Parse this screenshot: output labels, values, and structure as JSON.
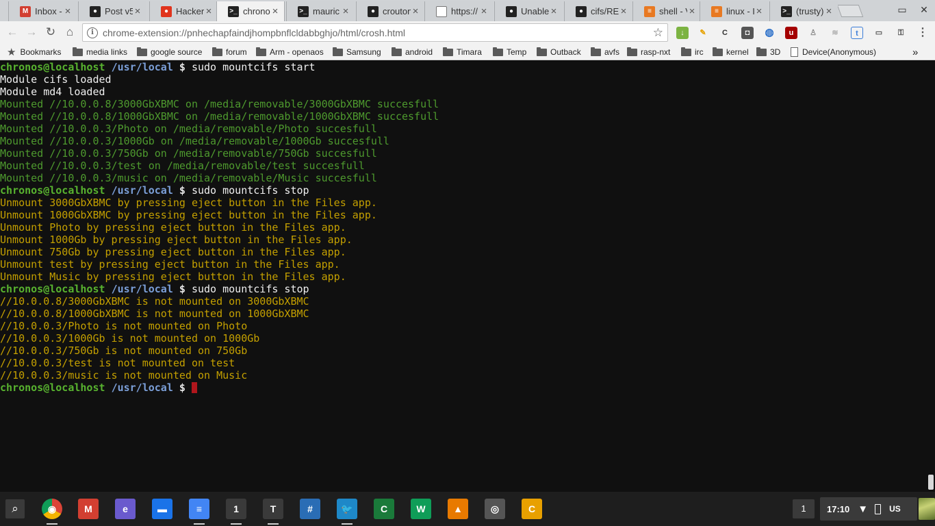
{
  "tabs": [
    {
      "title": "Inbox -",
      "icon": "gmail-icon",
      "color": "#d23f31",
      "glyph": "M"
    },
    {
      "title": "Post v5",
      "icon": "github-icon",
      "color": "#222222",
      "glyph": "●"
    },
    {
      "title": "Hacker",
      "icon": "hacker-news-icon",
      "color": "#e0331c",
      "glyph": "●"
    },
    {
      "title": "chrono",
      "icon": "terminal-icon",
      "color": "#222222",
      "glyph": ">_",
      "active": true
    },
    {
      "title": "mauric",
      "icon": "terminal-icon",
      "color": "#222222",
      "glyph": ">_"
    },
    {
      "title": "crouton",
      "icon": "github-icon",
      "color": "#222222",
      "glyph": "●"
    },
    {
      "title": "https://",
      "icon": "page-icon",
      "color": "#ffffff",
      "glyph": ""
    },
    {
      "title": "Unable",
      "icon": "github-icon",
      "color": "#222222",
      "glyph": "●"
    },
    {
      "title": "cifs/RE",
      "icon": "github-icon",
      "color": "#222222",
      "glyph": "●"
    },
    {
      "title": "shell - V",
      "icon": "stackexchange-icon",
      "color": "#e87922",
      "glyph": "≡"
    },
    {
      "title": "linux - I",
      "icon": "stackoverflow-icon",
      "color": "#e87922",
      "glyph": "≡"
    },
    {
      "title": "(trusty)",
      "icon": "terminal-icon",
      "color": "#222222",
      "glyph": ">_"
    }
  ],
  "toolbar": {
    "url": "chrome-extension://pnhechapfaindjhompbnflcldabbghjo/html/crosh.html",
    "info_glyph": "i",
    "star_glyph": "☆"
  },
  "bookmarks": {
    "label": "Bookmarks",
    "folders": [
      "media links",
      "google source",
      "forum",
      "Arm - openaos",
      "Samsung",
      "android",
      "Timara",
      "Temp",
      "Outback",
      "avfs",
      "rasp-nxt",
      "irc",
      "kernel",
      "3D"
    ],
    "page": "Device(Anonymous)",
    "overflow": "»"
  },
  "terminal": {
    "prompt_user": "chronos@localhost",
    "prompt_path": "/usr/local",
    "prompt_symbol": "$",
    "lines": [
      {
        "type": "prompt",
        "cmd": "sudo mountcifs start"
      },
      {
        "type": "white",
        "text": "Module cifs loaded"
      },
      {
        "type": "white",
        "text": "Module md4 loaded"
      },
      {
        "type": "green",
        "text": "Mounted //10.0.0.8/3000GbXBMC on /media/removable/3000GbXBMC succesfull"
      },
      {
        "type": "green",
        "text": "Mounted //10.0.0.8/1000GbXBMC on /media/removable/1000GbXBMC succesfull"
      },
      {
        "type": "green",
        "text": "Mounted //10.0.0.3/Photo on /media/removable/Photo succesfull"
      },
      {
        "type": "green",
        "text": "Mounted //10.0.0.3/1000Gb on /media/removable/1000Gb succesfull"
      },
      {
        "type": "green",
        "text": "Mounted //10.0.0.3/750Gb on /media/removable/750Gb succesfull"
      },
      {
        "type": "green",
        "text": "Mounted //10.0.0.3/test on /media/removable/test succesfull"
      },
      {
        "type": "green",
        "text": "Mounted //10.0.0.3/music on /media/removable/Music succesfull"
      },
      {
        "type": "prompt",
        "cmd": "sudo mountcifs stop"
      },
      {
        "type": "yellow",
        "text": "Unmount 3000GbXBMC by pressing eject button in the Files app."
      },
      {
        "type": "yellow",
        "text": "Unmount 1000GbXBMC by pressing eject button in the Files app."
      },
      {
        "type": "yellow",
        "text": "Unmount Photo by pressing eject button in the Files app."
      },
      {
        "type": "yellow",
        "text": "Unmount 1000Gb by pressing eject button in the Files app."
      },
      {
        "type": "yellow",
        "text": "Unmount 750Gb by pressing eject button in the Files app."
      },
      {
        "type": "yellow",
        "text": "Unmount test by pressing eject button in the Files app."
      },
      {
        "type": "yellow",
        "text": "Unmount Music by pressing eject button in the Files app."
      },
      {
        "type": "prompt",
        "cmd": "sudo mountcifs stop"
      },
      {
        "type": "yellow",
        "text": "//10.0.0.8/3000GbXBMC is not mounted on 3000GbXBMC"
      },
      {
        "type": "yellow",
        "text": "//10.0.0.8/1000GbXBMC is not mounted on 1000GbXBMC"
      },
      {
        "type": "yellow",
        "text": "//10.0.0.3/Photo is not mounted on Photo"
      },
      {
        "type": "yellow",
        "text": "//10.0.0.3/1000Gb is not mounted on 1000Gb"
      },
      {
        "type": "yellow",
        "text": "//10.0.0.3/750Gb is not mounted on 750Gb"
      },
      {
        "type": "yellow",
        "text": "//10.0.0.3/test is not mounted on test"
      },
      {
        "type": "yellow",
        "text": "//10.0.0.3/music is not mounted on Music"
      },
      {
        "type": "prompt",
        "cmd": "",
        "cursor": true
      }
    ]
  },
  "shelf": {
    "apps": [
      {
        "name": "chrome-icon",
        "color": "#4285f4",
        "glyph": "◉"
      },
      {
        "name": "gmail-icon",
        "color": "#d23f31",
        "glyph": "M"
      },
      {
        "name": "ssh-app-icon",
        "color": "#6a5acd",
        "glyph": "e"
      },
      {
        "name": "files-icon",
        "color": "#1a73e8",
        "glyph": "▬"
      },
      {
        "name": "docs-icon",
        "color": "#4285f4",
        "glyph": "≡"
      },
      {
        "name": "window-1-icon",
        "color": "#3a3a3a",
        "glyph": "1"
      },
      {
        "name": "window-t-icon",
        "color": "#3a3a3a",
        "glyph": "T"
      },
      {
        "name": "hashtag-app-icon",
        "color": "#2a6db5",
        "glyph": "#"
      },
      {
        "name": "bird-app-icon",
        "color": "#1e88c8",
        "glyph": "🐦"
      },
      {
        "name": "crosh-green-icon",
        "color": "#1a7a3a",
        "glyph": "C"
      },
      {
        "name": "sheets-icon",
        "color": "#0f9d58",
        "glyph": "W"
      },
      {
        "name": "vlc-icon",
        "color": "#e87a00",
        "glyph": "▲"
      },
      {
        "name": "camera-icon",
        "color": "#555555",
        "glyph": "◎"
      },
      {
        "name": "caret-editor-icon",
        "color": "#e8a000",
        "glyph": "C"
      }
    ],
    "window_count": "1",
    "clock": "17:10",
    "wifi_glyph": "▼",
    "ime": "US"
  },
  "colors": {
    "terminal_bg": "#101010",
    "prompt_user": "#58b32f",
    "prompt_path": "#7b9fd8",
    "mounted_text": "#4e9a2e",
    "warning_text": "#c4a000",
    "cursor": "#b0161c"
  }
}
